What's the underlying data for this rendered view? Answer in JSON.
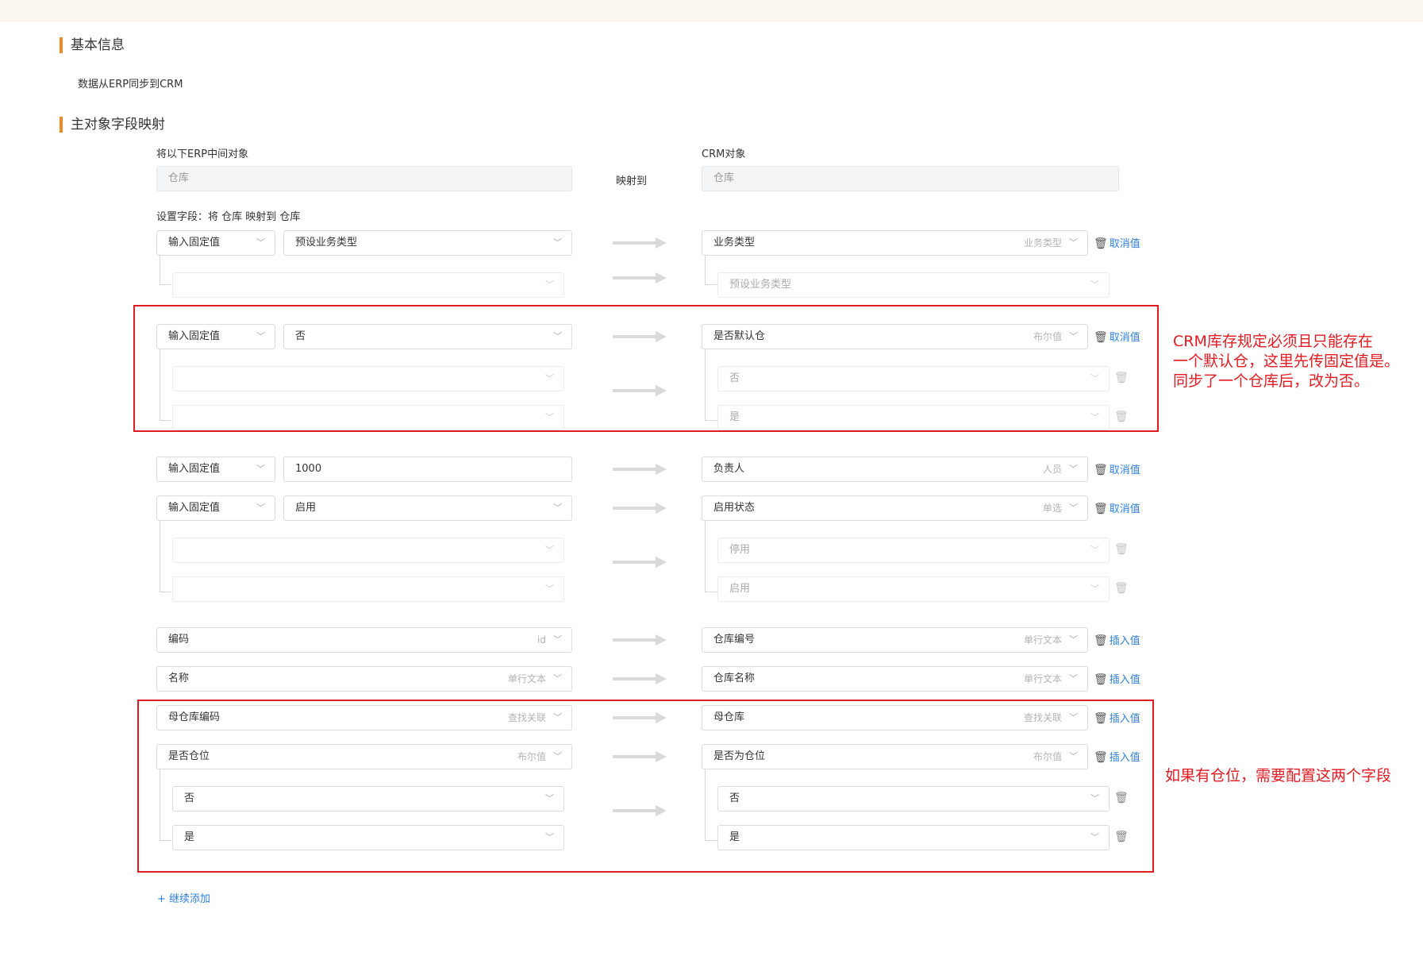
{
  "basic": {
    "title": "基本信息",
    "desc": "数据从ERP同步到CRM"
  },
  "mapping": {
    "title": "主对象字段映射",
    "src_label": "将以下ERP中间对象",
    "dst_label": "CRM对象",
    "src_object": "仓库",
    "mid_label": "映射到",
    "dst_object": "仓库",
    "set_fields_text": "设置字段：将 仓库 映射到 仓库"
  },
  "rows": {
    "r1": {
      "src_type": "输入固定值",
      "src_value": "预设业务类型",
      "dst_field": "业务类型",
      "dst_hint": "业务类型",
      "action": "取消值",
      "sub_dst": "预设业务类型"
    },
    "r2": {
      "src_type": "输入固定值",
      "src_value": "否",
      "dst_field": "是否默认仓",
      "dst_hint": "布尔值",
      "action": "取消值",
      "sub_dst_1": "否",
      "sub_dst_2": "是"
    },
    "r3": {
      "src_type": "输入固定值",
      "src_value": "1000",
      "dst_field": "负责人",
      "dst_hint": "人员",
      "action": "取消值"
    },
    "r4": {
      "src_type": "输入固定值",
      "src_value": "启用",
      "dst_field": "启用状态",
      "dst_hint": "单选",
      "action": "取消值",
      "sub_dst_1": "停用",
      "sub_dst_2": "启用"
    },
    "r5": {
      "src_field": "编码",
      "src_hint": "id",
      "dst_field": "仓库编号",
      "dst_hint": "单行文本",
      "action": "插入值"
    },
    "r6": {
      "src_field": "名称",
      "src_hint": "单行文本",
      "dst_field": "仓库名称",
      "dst_hint": "单行文本",
      "action": "插入值"
    },
    "r7": {
      "src_field": "母仓库编码",
      "src_hint": "查找关联",
      "dst_field": "母仓库",
      "dst_hint": "查找关联",
      "action": "插入值"
    },
    "r8": {
      "src_field": "是否仓位",
      "src_hint": "布尔值",
      "dst_field": "是否为仓位",
      "dst_hint": "布尔值",
      "action": "插入值",
      "sub_src_1": "否",
      "sub_src_2": "是",
      "sub_dst_1": "否",
      "sub_dst_2": "是"
    }
  },
  "add_more": "+ 继续添加",
  "annotations": {
    "note1_line1": "CRM库存规定必须且只能存在",
    "note1_line2": "一个默认仓，这里先传固定值是。",
    "note1_line3": "同步了一个仓库后，改为否。",
    "note2": "如果有仓位，需要配置这两个字段",
    "color": "#e11b22"
  },
  "colors": {
    "accent": "#f08a24",
    "link": "#2f7fd8"
  },
  "icons": {
    "chevron": "chevron-down-icon",
    "trash": "trash-icon",
    "arrow": "arrow-right-icon",
    "plus": "plus-icon"
  }
}
